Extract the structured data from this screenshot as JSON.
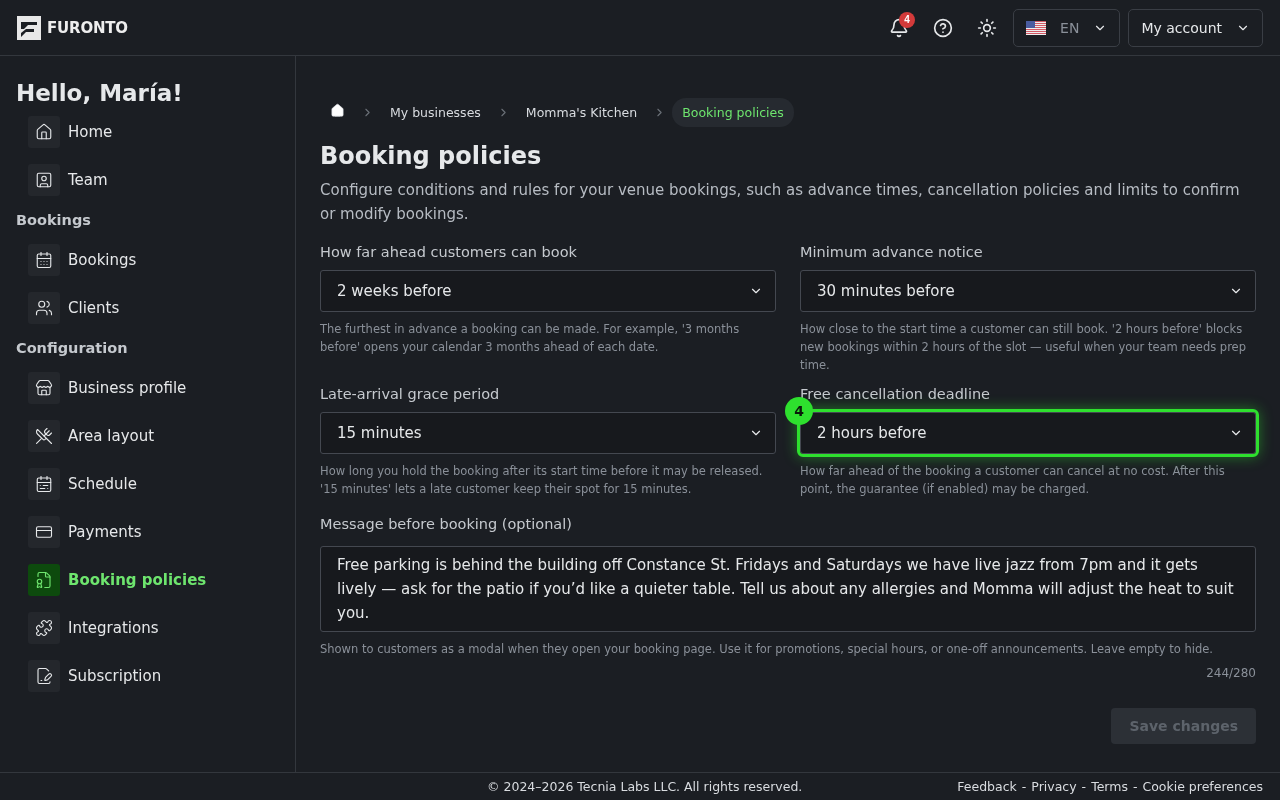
{
  "header": {
    "brand": "FURONTO",
    "notifications": "4",
    "language": "EN",
    "account": "My account"
  },
  "sidebar": {
    "greeting": "Hello, María!",
    "groups": [
      {
        "items": [
          {
            "label": "Home",
            "selected": false
          },
          {
            "label": "Team",
            "selected": false
          }
        ]
      },
      {
        "title": "Bookings",
        "items": [
          {
            "label": "Bookings",
            "selected": false
          },
          {
            "label": "Clients",
            "selected": false
          }
        ]
      },
      {
        "title": "Configuration",
        "items": [
          {
            "label": "Business profile",
            "selected": false
          },
          {
            "label": "Area layout",
            "selected": false
          },
          {
            "label": "Schedule",
            "selected": false
          },
          {
            "label": "Payments",
            "selected": false
          },
          {
            "label": "Booking policies",
            "selected": true
          },
          {
            "label": "Integrations",
            "selected": false
          },
          {
            "label": "Subscription",
            "selected": false
          }
        ]
      }
    ]
  },
  "breadcrumb": [
    {
      "label": "My businesses",
      "selected": false
    },
    {
      "label": "Momma's Kitchen",
      "selected": false
    },
    {
      "label": "Booking policies",
      "selected": true
    }
  ],
  "page": {
    "title": "Booking policies",
    "description": "Configure conditions and rules for your venue bookings, such as advance times, cancellation policies and limits to confirm or modify bookings."
  },
  "fields": [
    {
      "label": "How far ahead customers can book",
      "value": "2 weeks before",
      "help": "The furthest in advance a booking can be made. For example, '3 months before' opens your calendar 3 months ahead of each date.",
      "highlighted": false
    },
    {
      "label": "Minimum advance notice",
      "value": "30 minutes before",
      "help": "How close to the start time a customer can still book. '2 hours before' blocks new bookings within 2 hours of the slot — useful when your team needs prep time.",
      "highlighted": false
    },
    {
      "label": "Late-arrival grace period",
      "value": "15 minutes",
      "help": "How long you hold the booking after its start time before it may be released. '15 minutes' lets a late customer keep their spot for 15 minutes.",
      "highlighted": false
    },
    {
      "label": "Free cancellation deadline",
      "value": "2 hours before",
      "help": "How far ahead of the booking a customer can cancel at no cost. After this point, the guarantee (if enabled) may be charged.",
      "highlighted": true,
      "badge": "4"
    }
  ],
  "message": {
    "label": "Message before booking (optional)",
    "value": "Free parking is behind the building off Constance St. Fridays and Saturdays we have live jazz from 7pm and it gets lively — ask for the patio if you’d like a quieter table. Tell us about any allergies and Momma will adjust the heat to suit you.",
    "help": "Shown to customers as a modal when they open your booking page. Use it for promotions, special hours, or one-off announcements. Leave empty to hide.",
    "counter": "244/280"
  },
  "save_button": {
    "label": "Save changes",
    "disabled": true
  },
  "footer": {
    "copyright": "© 2024–2026 Tecnia Labs LLC. All rights reserved.",
    "links": [
      "Feedback",
      "Privacy",
      "Terms",
      "Cookie preferences"
    ],
    "separator": "-"
  }
}
